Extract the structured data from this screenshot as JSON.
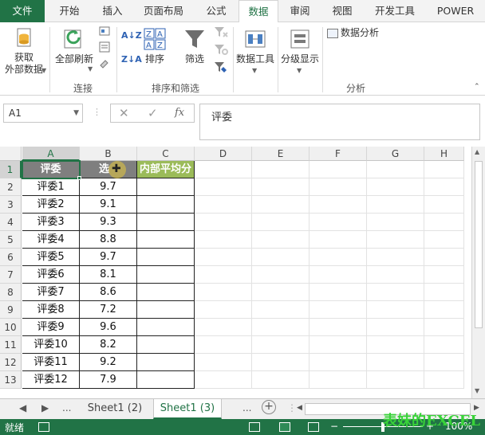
{
  "ribbon_tabs": [
    "文件",
    "开始",
    "插入",
    "页面布局",
    "公式",
    "数据",
    "审阅",
    "视图",
    "开发工具",
    "POWER"
  ],
  "ribbon": {
    "get_data_line1": "获取",
    "get_data_line2": "外部数据",
    "refresh_all": "全部刷新",
    "sort": "排序",
    "filter": "筛选",
    "data_tools": "数据工具",
    "outline": "分级显示",
    "data_analysis": "数据分析",
    "group_connections": "连接",
    "group_sort_filter": "排序和筛选",
    "group_analysis": "分析"
  },
  "formula_bar": {
    "name_box": "A1",
    "cancel": "✕",
    "enter": "✓",
    "fx": "fx",
    "content": "评委"
  },
  "grid": {
    "columns": [
      "A",
      "B",
      "C",
      "D",
      "E",
      "F",
      "G",
      "H"
    ],
    "header": {
      "a": "评委",
      "b": "选",
      "c": "内部平均分"
    },
    "rows": [
      {
        "n": "1"
      },
      {
        "n": "2",
        "judge": "评委1",
        "score": "9.7"
      },
      {
        "n": "3",
        "judge": "评委2",
        "score": "9.1"
      },
      {
        "n": "4",
        "judge": "评委3",
        "score": "9.3"
      },
      {
        "n": "5",
        "judge": "评委4",
        "score": "8.8"
      },
      {
        "n": "6",
        "judge": "评委5",
        "score": "9.7"
      },
      {
        "n": "7",
        "judge": "评委6",
        "score": "8.1"
      },
      {
        "n": "8",
        "judge": "评委7",
        "score": "8.6"
      },
      {
        "n": "9",
        "judge": "评委8",
        "score": "7.2"
      },
      {
        "n": "10",
        "judge": "评委9",
        "score": "9.6"
      },
      {
        "n": "11",
        "judge": "评委10",
        "score": "8.2"
      },
      {
        "n": "12",
        "judge": "评委11",
        "score": "9.2"
      },
      {
        "n": "13",
        "judge": "评委12",
        "score": "7.9"
      }
    ]
  },
  "sheet_tabs": {
    "ellipsis_left": "...",
    "sheet_a": "Sheet1 (2)",
    "sheet_b": "Sheet1 (3)",
    "ellipsis_right": "...",
    "add": "+"
  },
  "status": {
    "ready": "就绪",
    "zoom": "100%",
    "watermark": "表妹的EXCEL"
  },
  "colors": {
    "accent": "#217346",
    "header_grey": "#7f7f7f",
    "header_green": "#9bbb59"
  }
}
